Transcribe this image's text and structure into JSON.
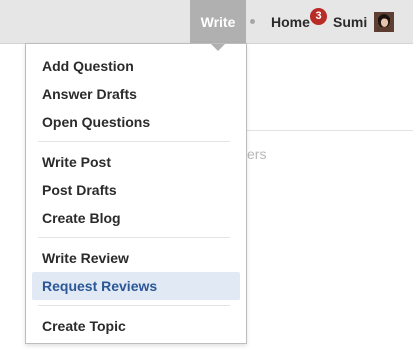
{
  "nav": {
    "write_label": "Write",
    "home_label": "Home",
    "notification_count": "3",
    "user_name": "Sumi"
  },
  "background": {
    "partial_text": "ers"
  },
  "menu": {
    "groups": [
      [
        "Add Question",
        "Answer Drafts",
        "Open Questions"
      ],
      [
        "Write Post",
        "Post Drafts",
        "Create Blog"
      ],
      [
        "Write Review",
        "Request Reviews"
      ],
      [
        "Create Topic"
      ]
    ],
    "active_item": "Request Reviews"
  },
  "colors": {
    "topbar_bg": "#e6e6e6",
    "write_tab_bg": "#b0b0b0",
    "badge_red": "#b92b27",
    "active_item_bg": "#e1e9f5",
    "active_item_text": "#2b5797"
  }
}
